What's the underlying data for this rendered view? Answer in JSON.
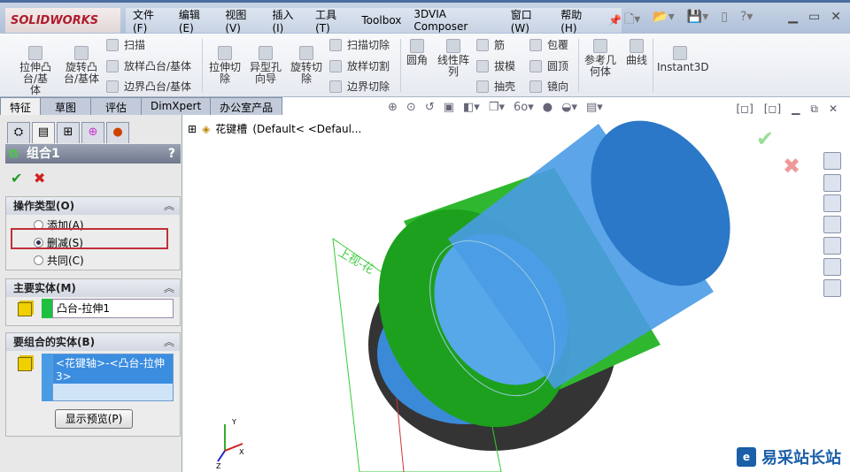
{
  "app": {
    "logo": "SOLIDWORKS",
    "menu": [
      "文件(F)",
      "编辑(E)",
      "视图(V)",
      "插入(I)",
      "工具(T)",
      "Toolbox",
      "3DVIA Composer",
      "窗口(W)",
      "帮助(H)"
    ]
  },
  "ribbon": {
    "extrude_boss": "拉伸凸台/基体",
    "revolve_boss": "旋转凸台/基体",
    "sweep": "扫描",
    "loft": "放样凸台/基体",
    "boundary": "边界凸台/基体",
    "extrude_cut": "拉伸切除",
    "hole_wizard": "异型孔向导",
    "revolve_cut": "旋转切除",
    "swept_cut": "扫描切除",
    "lofted_cut": "放样切割",
    "boundary_cut": "边界切除",
    "fillet": "圆角",
    "linear_pattern": "线性阵列",
    "rib": "筋",
    "draft": "拔模",
    "shell": "抽壳",
    "wrap": "包覆",
    "dome": "圆顶",
    "mirror": "镜向",
    "ref_geometry": "参考几何体",
    "curves": "曲线",
    "instant3d": "Instant3D"
  },
  "tabs": [
    "特征",
    "草图",
    "评估",
    "DimXpert",
    "办公室产品"
  ],
  "panel": {
    "title": "组合1",
    "help": "?",
    "op_group": "操作类型(O)",
    "options": [
      "添加(A)",
      "删减(S)",
      "共同(C)"
    ],
    "selected": 1,
    "main_group": "主要实体(M)",
    "main_body": "凸台-拉伸1",
    "combine_group": "要组合的实体(B)",
    "combine_body": "<花键轴>-<凸台-拉伸3>",
    "preview": "显示预览(P)"
  },
  "tree": {
    "name": "花键槽",
    "config": "(Default< <Defaul..."
  },
  "viewport": {
    "plane_label": "上视-花",
    "axes": [
      "X",
      "Y",
      "Z"
    ]
  },
  "watermark": "易采站长站"
}
